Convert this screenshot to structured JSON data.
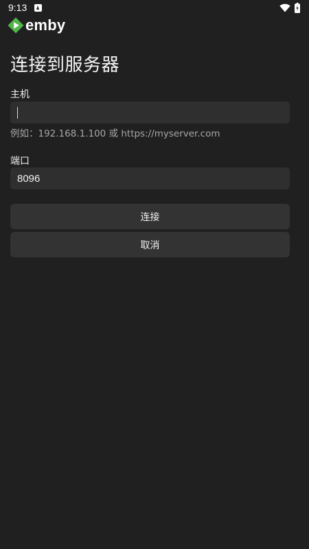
{
  "status_bar": {
    "time": "9:13",
    "icons": [
      "notification-icon",
      "wifi-icon",
      "battery-icon"
    ]
  },
  "app": {
    "logo_text": "emby",
    "brand_color": "#52b54b"
  },
  "page": {
    "title": "连接到服务器"
  },
  "form": {
    "host": {
      "label": "主机",
      "value": "",
      "hint": "例如：192.168.1.100 或 https://myserver.com"
    },
    "port": {
      "label": "端口",
      "value": "8096"
    }
  },
  "buttons": {
    "connect_label": "连接",
    "cancel_label": "取消"
  },
  "colors": {
    "background": "#202020",
    "field_background": "#2f2f2f",
    "button_background": "#333333",
    "hint_text": "#a8a8a8"
  }
}
